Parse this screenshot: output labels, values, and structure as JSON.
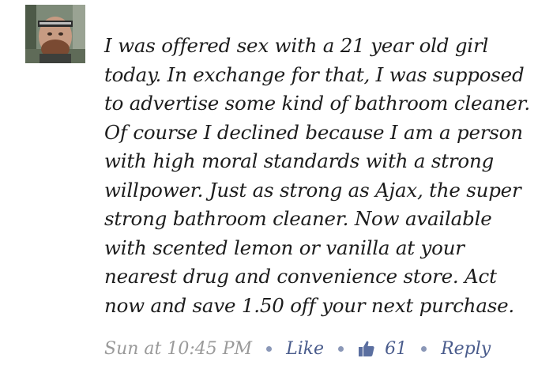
{
  "comment": {
    "lines": [
      "I was offered sex with a 21 year old girl",
      "today. In exchange for that, I was supposed",
      "to advertise some kind of bathroom cleaner.",
      "Of course I declined because I am a person",
      "with high moral standards with a strong",
      "willpower. Just as strong as Ajax, the super",
      "strong bathroom cleaner. Now available",
      "with scented lemon or vanilla at your",
      "nearest drug and convenience store. Act",
      "now and save 1.50 off your next purchase."
    ]
  },
  "meta": {
    "timestamp": "Sun at 10:45 PM",
    "like_label": "Like",
    "like_icon": "thumbs-up-icon",
    "like_count": "61",
    "reply_label": "Reply"
  },
  "colors": {
    "text": "#1c1c1c",
    "timestamp": "#9a9a9a",
    "link": "#4a5c8c",
    "separator": "#8a97b7"
  }
}
